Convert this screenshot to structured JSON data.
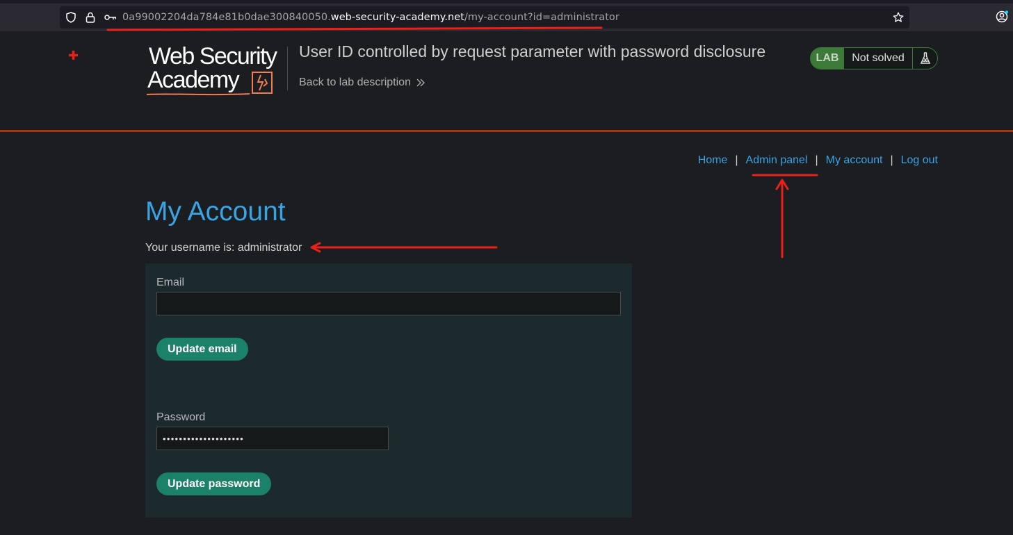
{
  "browser": {
    "url_subdomain": "0a99002204da784e81b0dae300840050.",
    "url_host": "web-security-academy.net",
    "url_path": "/my-account?id=administrator",
    "icons": [
      "shield-icon",
      "lock-icon",
      "key-icon",
      "bookmark-star-icon",
      "account-icon"
    ]
  },
  "lab": {
    "logo_line1": "Web Security",
    "logo_line2": "Academy",
    "title": "User ID controlled by request parameter with password disclosure",
    "back_link": "Back to lab description",
    "status_badge": "LAB",
    "status_text": "Not solved"
  },
  "nav": {
    "home": "Home",
    "admin_panel": "Admin panel",
    "my_account": "My account",
    "log_out": "Log out",
    "separator": "|"
  },
  "main": {
    "title": "My Account",
    "username_text": "Your username is: administrator",
    "email_label": "Email",
    "email_value": "",
    "update_email_button": "Update email",
    "password_label": "Password",
    "password_value": "••••••••••••••••••••",
    "update_password_button": "Update password"
  },
  "colors": {
    "accent_link": "#3aa3e3",
    "button_green": "#1b8168",
    "header_border": "#a6360f",
    "annotation_red": "#e8211a"
  }
}
